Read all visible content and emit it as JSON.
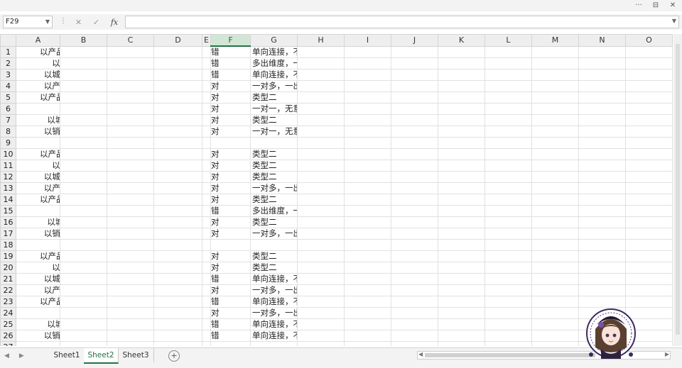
{
  "window": {
    "controls": [
      "···",
      "⊟",
      "✕"
    ]
  },
  "formula_bar": {
    "name_box": "F29",
    "cancel": "✕",
    "enter": "✓",
    "fx": "fx",
    "value": ""
  },
  "columns": [
    "A",
    "B",
    "C",
    "D",
    "E",
    "F",
    "G",
    "H",
    "I",
    "J",
    "K",
    "L",
    "M",
    "N",
    "O"
  ],
  "selected_column": "F",
  "rows": [
    {
      "num": "1",
      "desc": "以产品类型为维度，对区域编号进行计数汇总",
      "ok": "错",
      "note": "单向连接，不能跨表取"
    },
    {
      "num": "2",
      "desc": "以所属行业为维度，求城市编号的行数",
      "ok": "错",
      "note": "多出维度，一出度量"
    },
    {
      "num": "3",
      "desc": "以城市名为维度，对产品编号进行计数汇总",
      "ok": "错",
      "note": "单向连接，不能跨表取"
    },
    {
      "num": "4",
      "desc": "以产品系列为维度，对赢单率进行计数汇总",
      "ok": "对",
      "note": "一对多，一出维度，多出度量"
    },
    {
      "num": "5",
      "desc": "以产品类型为维度，对客户名称进行计数汇总",
      "ok": "对",
      "note": "类型二"
    },
    {
      "num": "6",
      "desc": "以企业规模为维度，对金额求和",
      "ok": "对",
      "note": "一对一，无意义"
    },
    {
      "num": "7",
      "desc": "以城市名为维度，对客户ID进行计数汇总",
      "ok": "对",
      "note": "类型二"
    },
    {
      "num": "8",
      "desc": "以销售阶段为维度，对第三方评级计数汇总",
      "ok": "对",
      "note": "一对一，无意义"
    },
    {
      "num": "9",
      "desc": "",
      "ok": "",
      "note": ""
    },
    {
      "num": "10",
      "desc": "以产品类型为维度，对区域编号进行计数汇总",
      "ok": "对",
      "note": "类型二"
    },
    {
      "num": "11",
      "desc": "以所属行业为维度，求城市编号的行数",
      "ok": "对",
      "note": "类型二"
    },
    {
      "num": "12",
      "desc": "以城市名为维度，对产品编号进行计数汇总",
      "ok": "对",
      "note": "类型二"
    },
    {
      "num": "13",
      "desc": "以产品系列为维度，对赢单率进行计数汇总",
      "ok": "对",
      "note": "一对多，一出维度，多出度量"
    },
    {
      "num": "14",
      "desc": "以产品类型为维度，对客户名称进行计数汇总",
      "ok": "对",
      "note": "类型二"
    },
    {
      "num": "15",
      "desc": "以企业规模为维度，对金额求和",
      "ok": "错",
      "note": "多出维度，一出度量"
    },
    {
      "num": "16",
      "desc": "以城市名为维度，对客户ID进行计数汇总",
      "ok": "对",
      "note": "类型二"
    },
    {
      "num": "17",
      "desc": "以销售阶段为维度，对第三方评级计数汇总",
      "ok": "对",
      "note": "一对多，一出维度，多出度量"
    },
    {
      "num": "18",
      "desc": "",
      "ok": "",
      "note": ""
    },
    {
      "num": "19",
      "desc": "以产品类型为维度，对区域编号进行计数汇总",
      "ok": "对",
      "note": "类型二"
    },
    {
      "num": "20",
      "desc": "以所属行业为维度，求城市编号的行数",
      "ok": "对",
      "note": "类型二"
    },
    {
      "num": "21",
      "desc": "以城市名为维度，对产品编号进行计数汇总",
      "ok": "错",
      "note": "单向连接，不能跨表取"
    },
    {
      "num": "22",
      "desc": "以产品系列为维度，对赢单率进行计数汇总",
      "ok": "对",
      "note": "一对多，一出维度，多出度量"
    },
    {
      "num": "23",
      "desc": "以产品类型为维度，对客户名称进行计数汇总",
      "ok": "错",
      "note": "单向连接，不能跨表取"
    },
    {
      "num": "24",
      "desc": "以企业规模为维度，对金额求和",
      "ok": "对",
      "note": "一对多，一出维度，多出度量"
    },
    {
      "num": "25",
      "desc": "以城市名为维度，对客户ID进行计数汇总",
      "ok": "错",
      "note": "单向连接，不能跨表取"
    },
    {
      "num": "26",
      "desc": "以销售阶段为维度，对第三方评级计数汇总",
      "ok": "错",
      "note": "单向连接，不能跨表取"
    },
    {
      "num": "27",
      "desc": "",
      "ok": "",
      "note": ""
    }
  ],
  "sheets": [
    {
      "label": "Sheet1",
      "active": false
    },
    {
      "label": "Sheet2",
      "active": true
    },
    {
      "label": "Sheet3",
      "active": false
    }
  ],
  "add_sheet": "+",
  "accent_color": "#217346"
}
